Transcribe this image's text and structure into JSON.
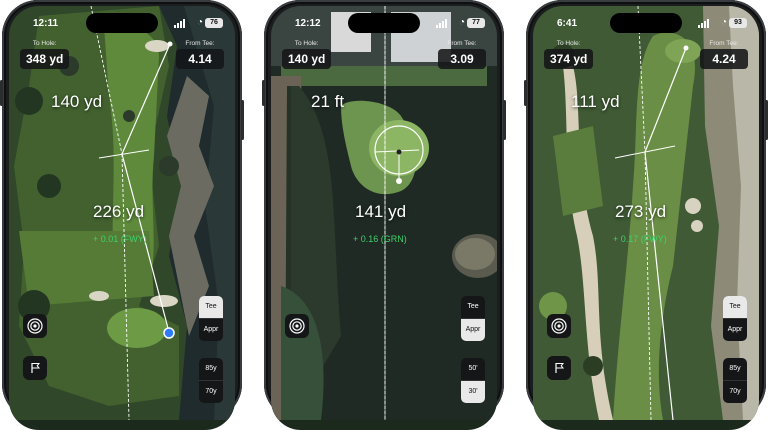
{
  "phones": [
    {
      "status": {
        "time": "12:11",
        "battery": "76"
      },
      "to_hole_label": "To Hole:",
      "to_hole_value": "348 yd",
      "from_tee_label": "From Tee:",
      "from_tee_value": "4.14",
      "upper_distance": "140 yd",
      "lower_distance": "226 yd",
      "strokes_gained": "+ 0.01 (FWY)",
      "lie_options": [
        "Tee",
        "Appr"
      ],
      "active_lie": "Tee",
      "club_options": [
        "85y",
        "70y"
      ]
    },
    {
      "status": {
        "time": "12:12",
        "battery": "77"
      },
      "to_hole_label": "To Hole:",
      "to_hole_value": "140 yd",
      "from_tee_label": "From Tee:",
      "from_tee_value": "3.09",
      "upper_distance": "21 ft",
      "lower_distance": "141 yd",
      "strokes_gained": "+ 0.16 (GRN)",
      "lie_options": [
        "Tee",
        "Appr"
      ],
      "active_lie": "Appr",
      "club_options": [
        "50'",
        "30'"
      ]
    },
    {
      "status": {
        "time": "6:41",
        "battery": "93"
      },
      "to_hole_label": "To Hole:",
      "to_hole_value": "374 yd",
      "from_tee_label": "From Tee:",
      "from_tee_value": "4.24",
      "upper_distance": "111 yd",
      "lower_distance": "273 yd",
      "strokes_gained": "+ 0.17 (FWY)",
      "lie_options": [
        "Tee",
        "Appr"
      ],
      "active_lie": "Tee",
      "club_options": [
        "85y",
        "70y"
      ]
    }
  ],
  "colors": {
    "strokes_gained": "#3fd16a",
    "location_dot": "#2f7bff",
    "control_bg": "#151617",
    "segment_active": "#e9e9e9"
  },
  "icons": {
    "target_button": "target-icon",
    "flag_button": "flag-icon",
    "location": "location-arrow-icon"
  }
}
